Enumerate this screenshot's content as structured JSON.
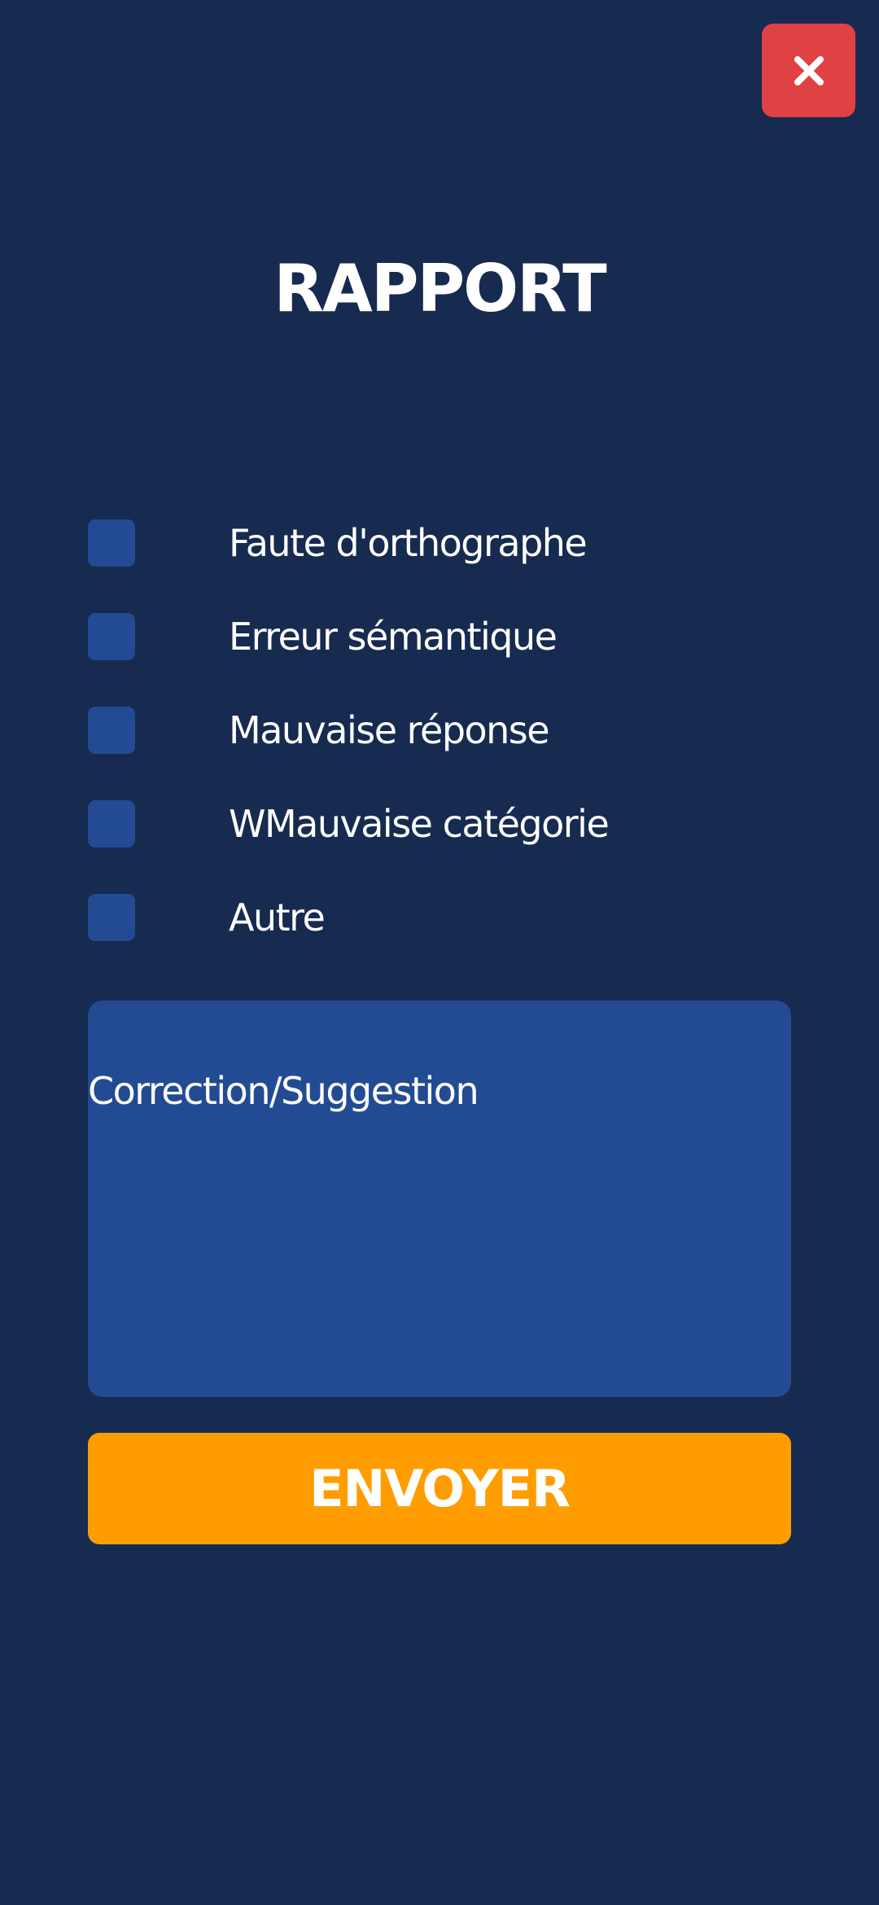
{
  "colors": {
    "background": "#172a4f",
    "close_button": "#e04145",
    "checkbox": "#234b93",
    "textarea": "#224b93",
    "send_button": "#ff9d00",
    "text": "#ffffff"
  },
  "close_button": {
    "icon": "close-icon"
  },
  "title": "RAPPORT",
  "options": [
    {
      "label": "Faute d'orthographe",
      "checked": false
    },
    {
      "label": "Erreur sémantique",
      "checked": false
    },
    {
      "label": "Mauvaise réponse",
      "checked": false
    },
    {
      "label": "WMauvaise catégorie",
      "checked": false
    },
    {
      "label": "Autre",
      "checked": false
    }
  ],
  "comment": {
    "placeholder": "Correction/Suggestion",
    "value": ""
  },
  "send_label": "ENVOYER"
}
